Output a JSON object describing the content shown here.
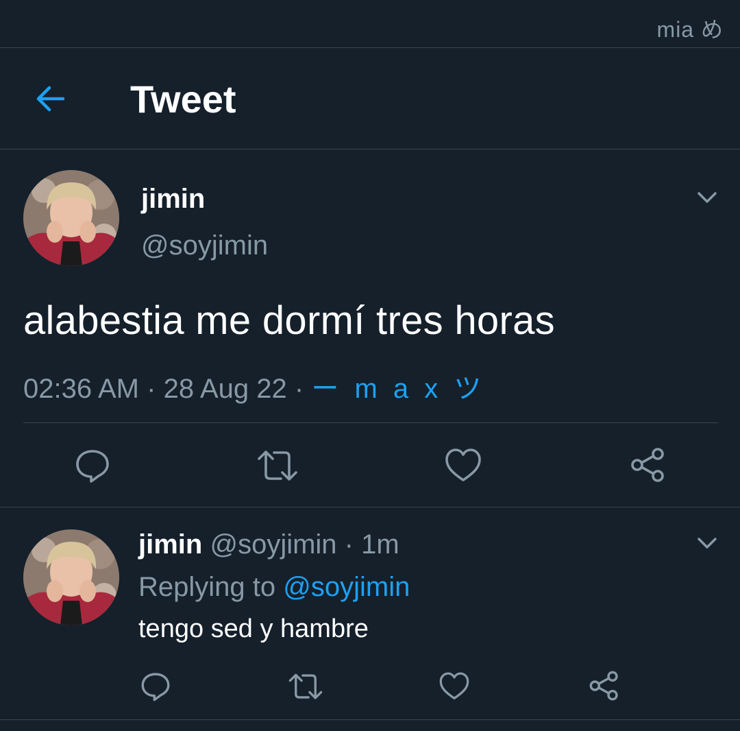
{
  "status_bar": {
    "text": "mia め"
  },
  "header": {
    "title": "Tweet",
    "back_icon": "arrow-left-icon"
  },
  "main_tweet": {
    "author_name": "jimin",
    "author_handle": "@soyjimin",
    "text": "alabestia me dormí tres horas",
    "time": "02:36 AM",
    "date": "28 Aug 22",
    "separator": "·",
    "source": "ー m a x ツ",
    "actions": [
      "reply-icon",
      "retweet-icon",
      "like-icon",
      "share-icon"
    ]
  },
  "reply_tweet": {
    "author_name": "jimin",
    "author_handle": "@soyjimin",
    "separator": "·",
    "time_ago": "1m",
    "replying_label": "Replying to",
    "replying_to": "@soyjimin",
    "text": "tengo sed y hambre",
    "actions": [
      "reply-icon",
      "retweet-icon",
      "like-icon",
      "share-icon"
    ]
  },
  "colors": {
    "background": "#15202b",
    "divider": "#38444d",
    "secondary_text": "#8899a6",
    "accent": "#1da1f2",
    "primary_text": "#ffffff"
  }
}
